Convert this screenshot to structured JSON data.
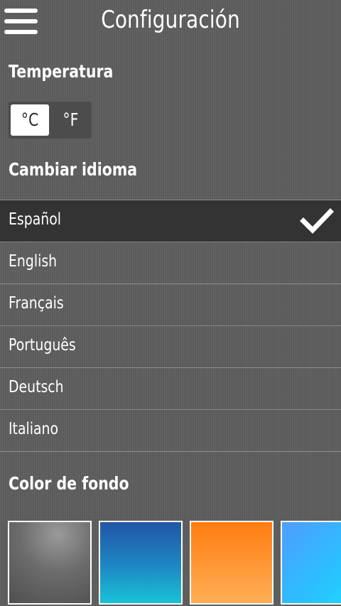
{
  "header": {
    "title": "Configuración",
    "menu_icon": "hamburger-menu-icon"
  },
  "temperature": {
    "heading": "Temperatura",
    "celsius_label": "°C",
    "fahrenheit_label": "°F",
    "selected": "°C"
  },
  "language": {
    "heading": "Cambiar idioma",
    "items": [
      {
        "label": "Español",
        "selected": true
      },
      {
        "label": "English",
        "selected": false
      },
      {
        "label": "Français",
        "selected": false
      },
      {
        "label": "Português",
        "selected": false
      },
      {
        "label": "Deutsch",
        "selected": false
      },
      {
        "label": "Italiano",
        "selected": false
      }
    ],
    "check_icon": "checkmark-icon"
  },
  "background_color": {
    "heading": "Color de fondo",
    "swatches": [
      {
        "name": "gray",
        "color": "#6c6c6c"
      },
      {
        "name": "blue",
        "color": "#1e88c4"
      },
      {
        "name": "orange",
        "color": "#ff8a20"
      },
      {
        "name": "cyan",
        "color": "#2bc0ff"
      }
    ]
  },
  "colors": {
    "background": "#5d5d5d",
    "selected_row": "#333333",
    "toggle_bg": "#4c4c4c",
    "text": "#ffffff"
  }
}
